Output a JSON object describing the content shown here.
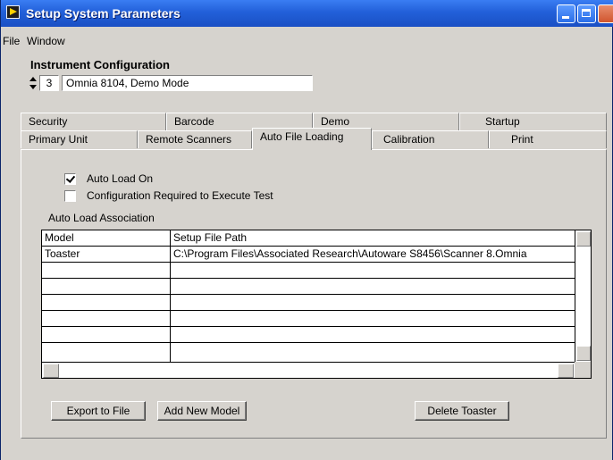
{
  "window": {
    "title": "Setup System Parameters"
  },
  "menubar": {
    "file": "File",
    "window": "Window"
  },
  "instrument": {
    "heading": "Instrument Configuration",
    "index": "3",
    "config_name": "Omnia 8104, Demo Mode"
  },
  "tabs_back": [
    "Security",
    "Barcode",
    "Demo",
    "Startup"
  ],
  "tabs_front": [
    "Primary Unit",
    "Remote Scanners",
    "Auto File Loading",
    "Calibration",
    "Print"
  ],
  "active_tab": "Auto File Loading",
  "options": {
    "auto_load_on": {
      "label": "Auto Load On",
      "checked": true
    },
    "config_required": {
      "label": "Configuration Required to Execute Test",
      "checked": false
    }
  },
  "association": {
    "label": "Auto Load Association",
    "headers": [
      "Model",
      "Setup File Path"
    ],
    "rows": [
      [
        "Toaster",
        "C:\\Program Files\\Associated Research\\Autoware S8456\\Scanner 8.Omnia"
      ],
      [
        "",
        ""
      ],
      [
        "",
        ""
      ],
      [
        "",
        ""
      ],
      [
        "",
        ""
      ],
      [
        "",
        ""
      ],
      [
        "",
        ""
      ]
    ]
  },
  "buttons": {
    "export": "Export to File",
    "add_model": "Add New Model",
    "delete": "Delete Toaster"
  }
}
